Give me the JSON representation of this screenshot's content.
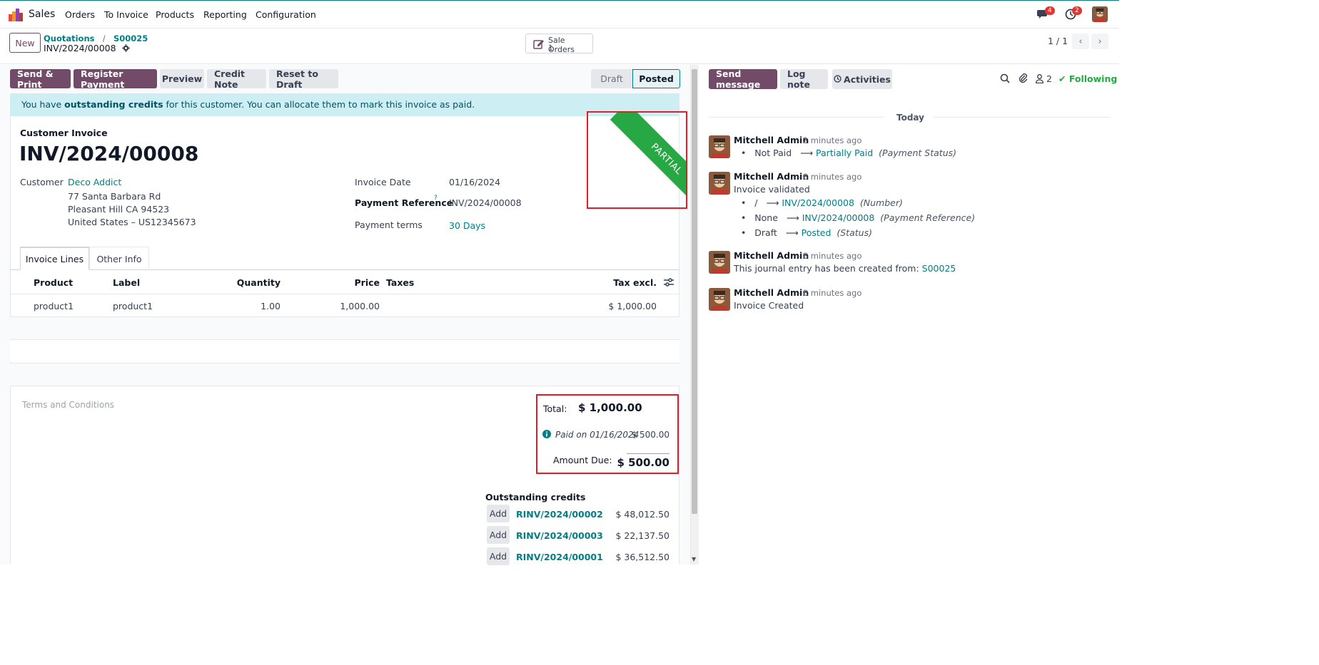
{
  "nav": {
    "app_name": "Sales",
    "menu": [
      "Orders",
      "To Invoice",
      "Products",
      "Reporting",
      "Configuration"
    ],
    "messages_badge": "4",
    "activities_badge": "2"
  },
  "control_panel": {
    "new_label": "New",
    "breadcrumb": [
      "Quotations",
      "S00025"
    ],
    "record_name": "INV/2024/00008",
    "smart_button": {
      "label": "Sale Orders",
      "count": "1"
    },
    "pager": "1 / 1"
  },
  "actions": {
    "send_print": "Send & Print",
    "register_payment": "Register Payment",
    "preview": "Preview",
    "credit_note": "Credit Note",
    "reset_draft": "Reset to Draft"
  },
  "status": {
    "draft": "Draft",
    "posted": "Posted"
  },
  "alert": {
    "prefix": "You have ",
    "bold": "outstanding credits",
    "suffix": " for this customer. You can allocate them to mark this invoice as paid."
  },
  "ribbon": "PARTIAL",
  "invoice": {
    "type_label": "Customer Invoice",
    "number": "INV/2024/00008",
    "customer_label": "Customer",
    "customer_name": "Deco Addict",
    "address": [
      "77 Santa Barbara Rd",
      "Pleasant Hill CA 94523",
      "United States – US12345673"
    ],
    "invoice_date_label": "Invoice Date",
    "invoice_date": "01/16/2024",
    "payment_ref_label": "Payment Reference",
    "payment_ref_help": "?",
    "payment_ref": "INV/2024/00008",
    "payment_terms_label": "Payment terms",
    "payment_terms": "30 Days"
  },
  "tabs": [
    "Invoice Lines",
    "Other Info"
  ],
  "lines": {
    "headers": {
      "product": "Product",
      "label": "Label",
      "quantity": "Quantity",
      "price": "Price",
      "taxes": "Taxes",
      "tax_excl": "Tax excl."
    },
    "rows": [
      {
        "product": "product1",
        "label": "product1",
        "quantity": "1.00",
        "price": "1,000.00",
        "taxes": "",
        "tax_excl": "$ 1,000.00"
      }
    ]
  },
  "terms_placeholder": "Terms and Conditions",
  "totals": {
    "total_label": "Total:",
    "total_value": "$ 1,000.00",
    "paid_label": "Paid on 01/16/2024",
    "paid_value": "$ 500.00",
    "due_label": "Amount Due:",
    "due_value": "$ 500.00"
  },
  "outstanding": {
    "title": "Outstanding credits",
    "add_label": "Add",
    "credits": [
      {
        "name": "RINV/2024/00002",
        "amount": "$ 48,012.50"
      },
      {
        "name": "RINV/2024/00003",
        "amount": "$ 22,137.50"
      },
      {
        "name": "RINV/2024/00001",
        "amount": "$ 36,512.50"
      }
    ]
  },
  "chatter": {
    "send_message": "Send message",
    "log_note": "Log note",
    "activities": "Activities",
    "followers_count": "2",
    "following": "Following",
    "date_separator": "Today",
    "messages": [
      {
        "author": "Mitchell Admin",
        "ago": "- 2 minutes ago"
      },
      {
        "author": "Mitchell Admin",
        "ago": "- 8 minutes ago",
        "body": "Invoice validated"
      },
      {
        "author": "Mitchell Admin",
        "ago": "- 8 minutes ago",
        "body": "This journal entry has been created from: ",
        "link": "S00025"
      },
      {
        "author": "Mitchell Admin",
        "ago": "- 8 minutes ago",
        "body": "Invoice Created"
      }
    ],
    "tracking_1": [
      {
        "old": "Not Paid",
        "new": "Partially Paid",
        "field": "(Payment Status)"
      }
    ],
    "tracking_2": [
      {
        "old": "/",
        "new": "INV/2024/00008",
        "field": "(Number)"
      },
      {
        "old": "None",
        "new": "INV/2024/00008",
        "field": "(Payment Reference)"
      },
      {
        "old": "Draft",
        "new": "Posted",
        "field": "(Status)"
      }
    ]
  },
  "colors": {
    "brand": "#714b67",
    "link": "#017e84",
    "ribbon": "#28a745",
    "highlight": "#e11d2a"
  }
}
